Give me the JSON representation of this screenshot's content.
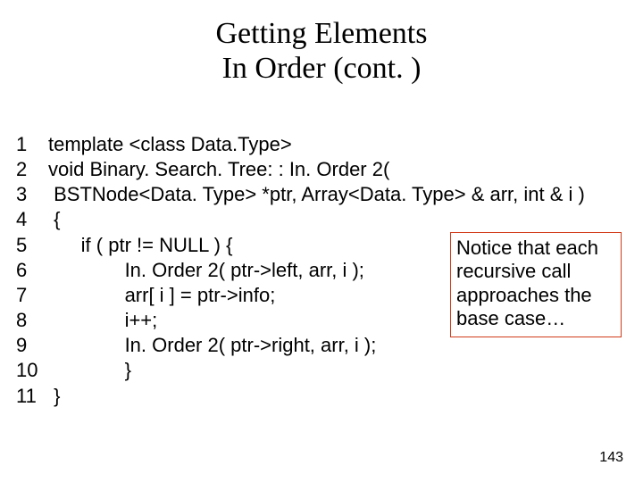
{
  "title": {
    "line1": "Getting Elements",
    "line2": "In Order (cont. )"
  },
  "code": [
    {
      "n": "1",
      "t": "template <class Data.Type>"
    },
    {
      "n": "2",
      "t": "void Binary. Search. Tree: : In. Order 2("
    },
    {
      "n": "3",
      "t": " BSTNode<Data. Type> *ptr, Array<Data. Type> & arr, int & i )"
    },
    {
      "n": "4",
      "t": " {"
    },
    {
      "n": "5",
      "t": "      if ( ptr != NULL ) {"
    },
    {
      "n": "6",
      "t": "              In. Order 2( ptr->left, arr, i );"
    },
    {
      "n": "7",
      "t": "              arr[ i ] = ptr->info;"
    },
    {
      "n": "8",
      "t": "              i++;"
    },
    {
      "n": "9",
      "t": "              In. Order 2( ptr->right, arr, i );"
    },
    {
      "n": "10",
      "t": "              }"
    },
    {
      "n": "11",
      "t": " }"
    }
  ],
  "callout": "Notice that each recursive call approaches the base case…",
  "page_number": "143"
}
